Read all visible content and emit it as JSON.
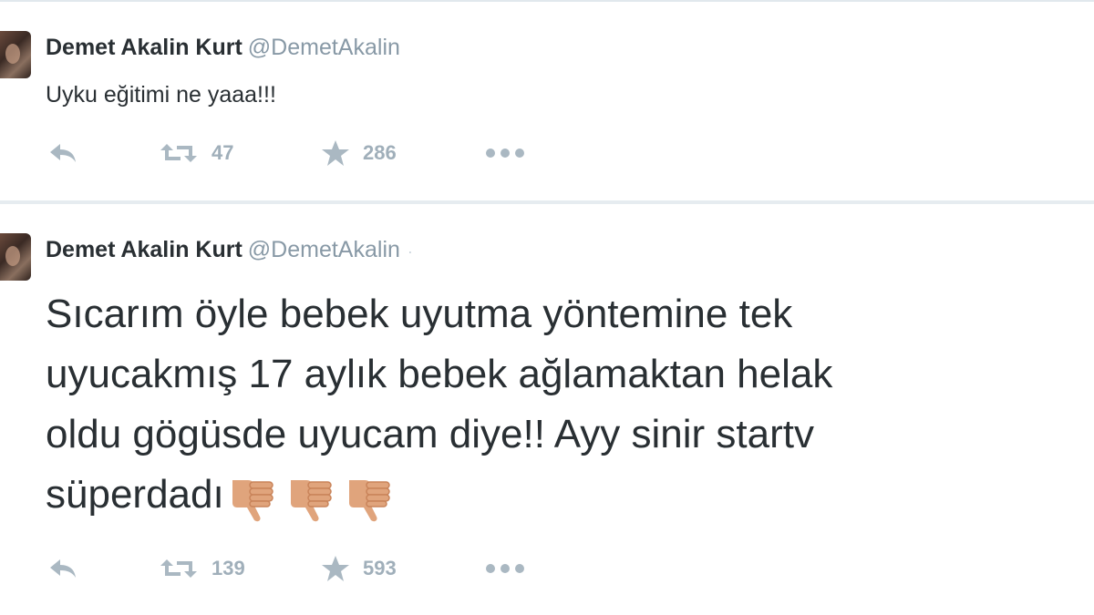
{
  "tweets": [
    {
      "author_name": "Demet Akalin Kurt",
      "author_handle": "@DemetAkalin",
      "text": "Uyku eğitimi ne yaaa!!!",
      "retweets": "47",
      "favorites": "286",
      "emojis": []
    },
    {
      "author_name": "Demet Akalin Kurt",
      "author_handle": "@DemetAkalin",
      "text_lines": [
        "Sıcarım öyle bebek uyutma yöntemine tek",
        "uyucakmış 17 aylık bebek ağlamaktan helak",
        "oldu gögüsde uyucam diye!! Ayy sinir startv",
        "süperdadı"
      ],
      "retweets": "139",
      "favorites": "593",
      "emojis": [
        "thumbs-down",
        "thumbs-down",
        "thumbs-down"
      ],
      "separator": "·"
    }
  ],
  "icons": {
    "reply": "reply-icon",
    "retweet": "retweet-icon",
    "favorite": "star-icon",
    "more": "more-icon",
    "emoji": "thumbs-down-icon"
  },
  "colors": {
    "text": "#292f33",
    "handle": "#8899a6",
    "action": "#aab8c2",
    "divider": "#e6ecf0",
    "emoji": "#e0a47c"
  }
}
